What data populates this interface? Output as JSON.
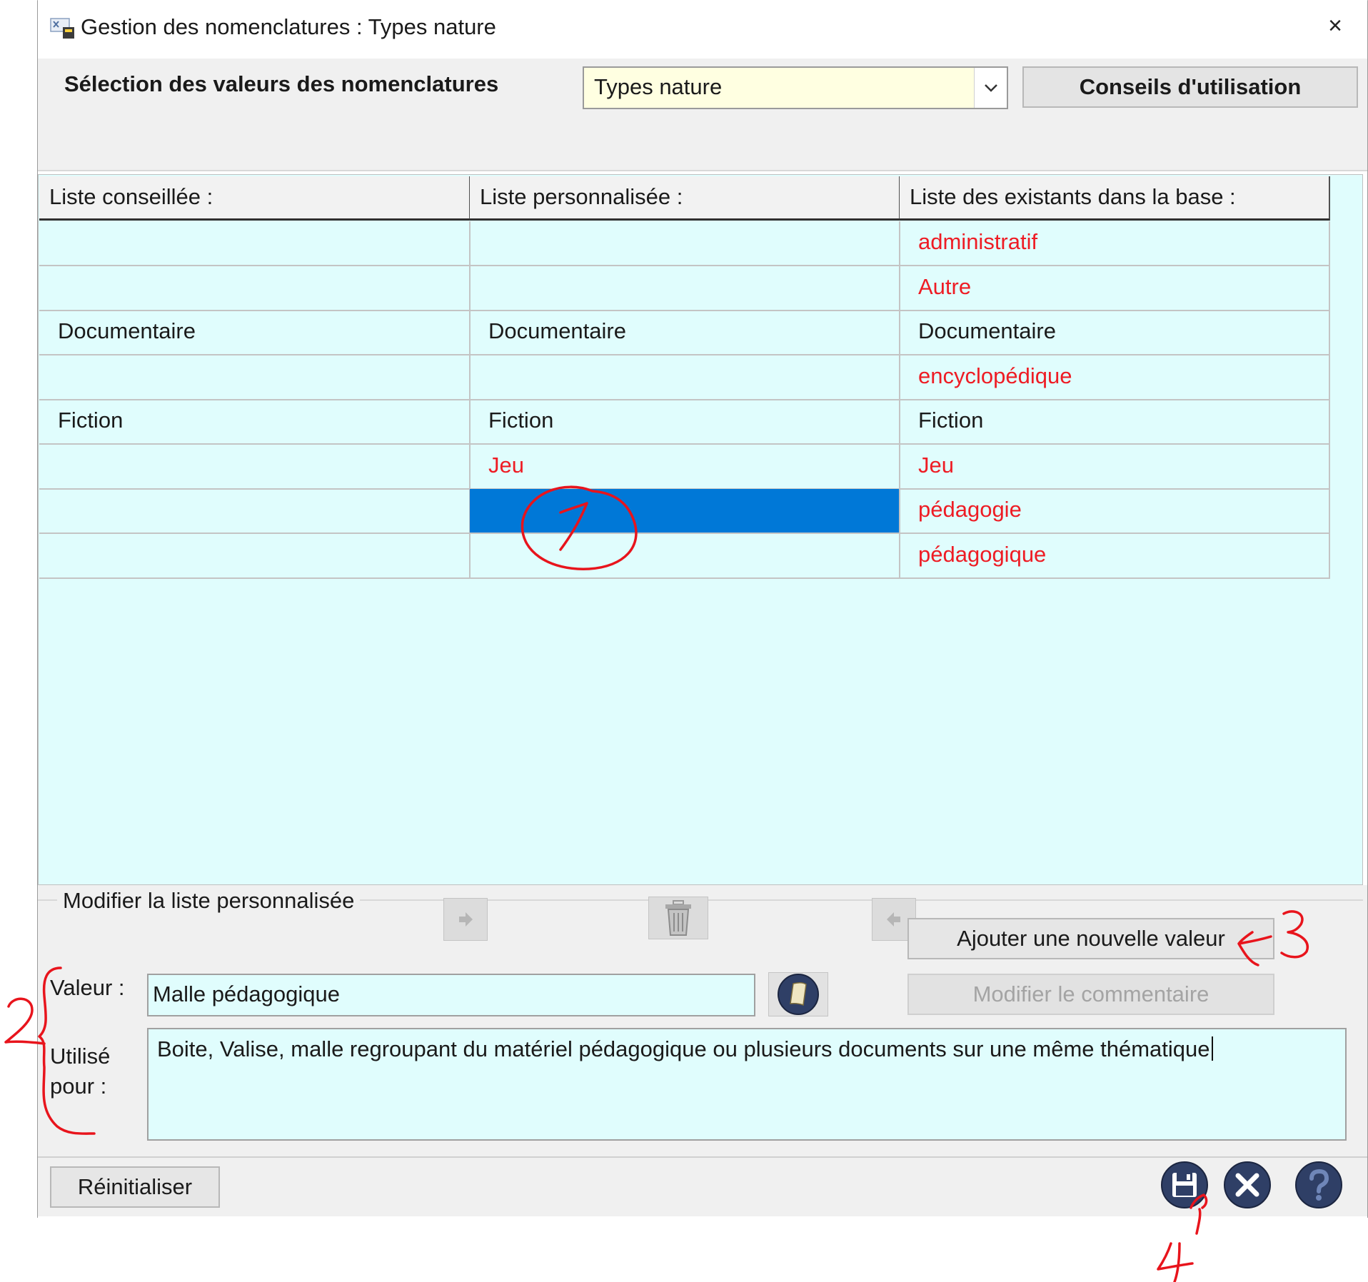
{
  "window": {
    "title": "Gestion des nomenclatures :  Types nature",
    "close_glyph": "×"
  },
  "selection": {
    "label": "Sélection des valeurs des nomenclatures",
    "combo_value": "Types nature",
    "conseils_button": "Conseils d'utilisation"
  },
  "grid": {
    "headers": [
      "Liste conseillée :",
      "Liste personnalisée :",
      "Liste des existants dans la base :"
    ],
    "rows": [
      {
        "conseillee": "",
        "personnalisee": "",
        "existants": "administratif"
      },
      {
        "conseillee": "",
        "personnalisee": "",
        "existants": "Autre"
      },
      {
        "conseillee": "Documentaire",
        "personnalisee": "Documentaire",
        "existants": "Documentaire"
      },
      {
        "conseillee": "",
        "personnalisee": "",
        "existants": "encyclopédique"
      },
      {
        "conseillee": "Fiction",
        "personnalisee": "Fiction",
        "existants": "Fiction"
      },
      {
        "conseillee": "",
        "personnalisee": "Jeu",
        "existants": "Jeu"
      },
      {
        "conseillee": "",
        "personnalisee": "",
        "existants": "pédagogie"
      },
      {
        "conseillee": "",
        "personnalisee": "",
        "existants": "pédagogique"
      }
    ],
    "selected_row": 6,
    "colors": {
      "normal": "#1a1a1a",
      "not_in_list": "#ee1c24",
      "selection": "#0078d7",
      "background": "#e0fdfd"
    }
  },
  "modify": {
    "group_label": "Modifier la liste personnalisée",
    "add_button": "Ajouter une nouvelle valeur",
    "comment_button": "Modifier le commentaire",
    "valeur_label": "Valeur :",
    "valeur_value": "Malle pédagogique",
    "utilise_label_1": "Utilisé",
    "utilise_label_2": "pour :",
    "utilise_value": "Boite, Valise, malle regroupant du matériel pédagogique ou plusieurs documents sur une même thématique"
  },
  "footer": {
    "reset_button": "Réinitialiser"
  },
  "annotations": [
    "1",
    "2",
    "3",
    "4"
  ]
}
